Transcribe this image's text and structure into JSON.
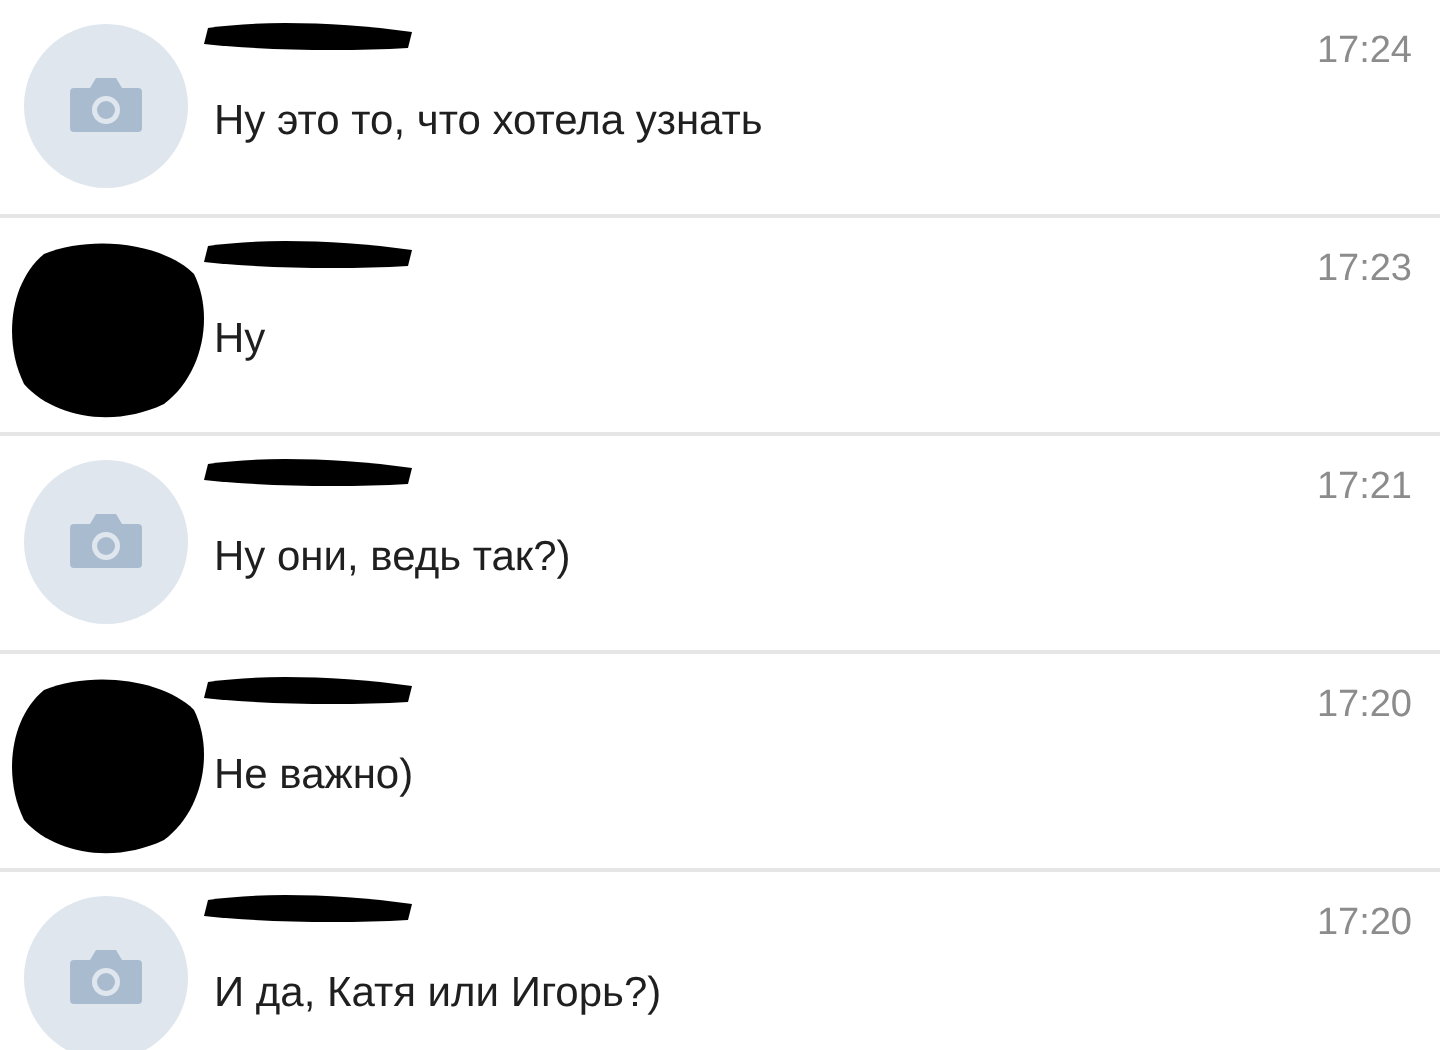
{
  "chats": [
    {
      "kind": "camera",
      "message": "Ну это то, что хотела узнать",
      "time": "17:24"
    },
    {
      "kind": "redacted",
      "message": "Ну",
      "time": "17:23"
    },
    {
      "kind": "camera",
      "message": "Ну они, ведь так?)",
      "time": "17:21"
    },
    {
      "kind": "redacted",
      "message": "Не важно)",
      "time": "17:20"
    },
    {
      "kind": "camera",
      "message": "И да, Катя или Игорь?)",
      "time": "17:20"
    }
  ]
}
